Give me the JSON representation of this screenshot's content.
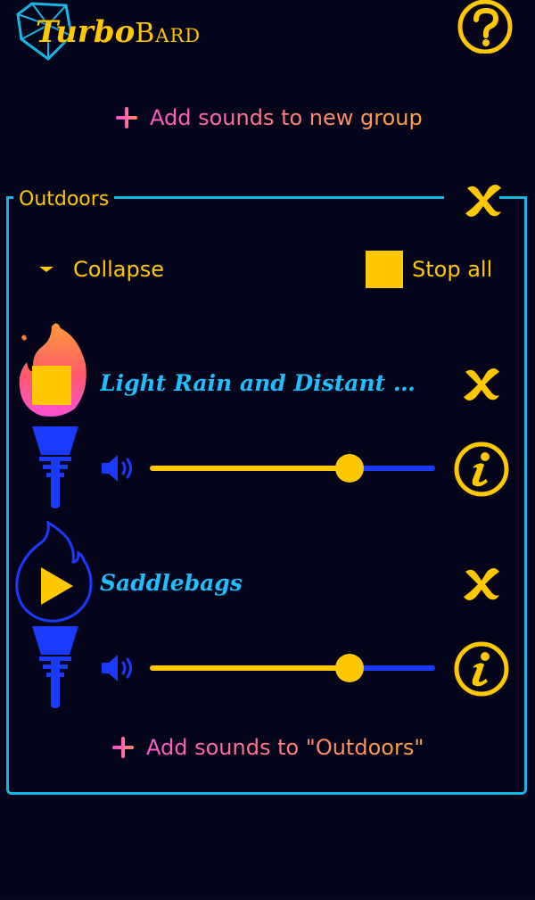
{
  "header": {
    "logo_word1": "Turbo",
    "logo_word2": "Bard",
    "help_icon": "question-mark-circle-icon"
  },
  "add_group_label": "Add sounds to new group",
  "group": {
    "title": "Outdoors",
    "collapse_label": "Collapse",
    "stop_all_label": "Stop all",
    "add_sounds_label": "Add sounds to \"Outdoors\"",
    "tracks": [
      {
        "title": "Light Rain and Distant Thunder",
        "state": "playing",
        "volume": 0.7
      },
      {
        "title": "Saddlebags",
        "state": "stopped",
        "volume": 0.7
      }
    ]
  },
  "colors": {
    "background": "#04041a",
    "accent_yellow": "#ffc800",
    "accent_cyan": "#17b6e6",
    "title_blue": "#1fbfff",
    "icon_blue": "#1a3aff",
    "link_gradient_start": "#ff4fd8",
    "link_gradient_end": "#ffa53a"
  }
}
